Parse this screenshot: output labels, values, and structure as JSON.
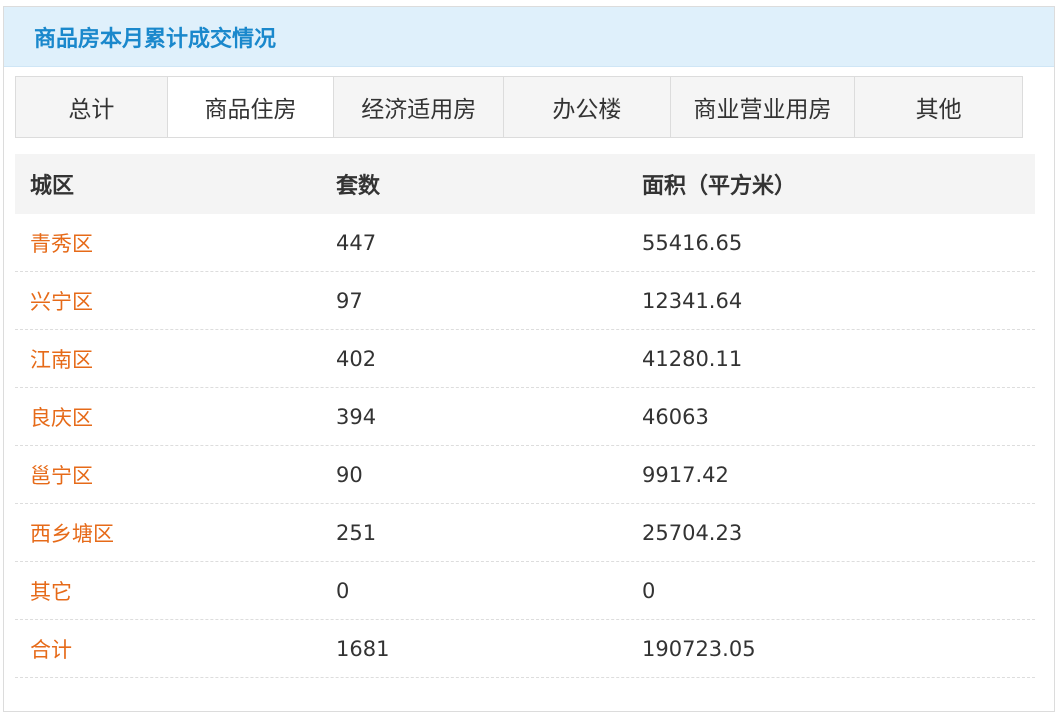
{
  "header": {
    "title": "商品房本月累计成交情况"
  },
  "tabs": [
    {
      "label": "总计",
      "active": false
    },
    {
      "label": "商品住房",
      "active": true
    },
    {
      "label": "经济适用房",
      "active": false
    },
    {
      "label": "办公楼",
      "active": false
    },
    {
      "label": "商业营业用房",
      "active": false
    },
    {
      "label": "其他",
      "active": false
    }
  ],
  "table": {
    "columns": [
      "城区",
      "套数",
      "面积（平方米）"
    ],
    "rows": [
      [
        "青秀区",
        "447",
        "55416.65"
      ],
      [
        "兴宁区",
        "97",
        "12341.64"
      ],
      [
        "江南区",
        "402",
        "41280.11"
      ],
      [
        "良庆区",
        "394",
        "46063"
      ],
      [
        "邕宁区",
        "90",
        "9917.42"
      ],
      [
        "西乡塘区",
        "251",
        "25704.23"
      ],
      [
        "其它",
        "0",
        "0"
      ],
      [
        "合计",
        "1681",
        "190723.05"
      ]
    ]
  },
  "colors": {
    "title": "#1a88cc",
    "header_bg": "#dff0fb",
    "district_link": "#e66a18"
  }
}
